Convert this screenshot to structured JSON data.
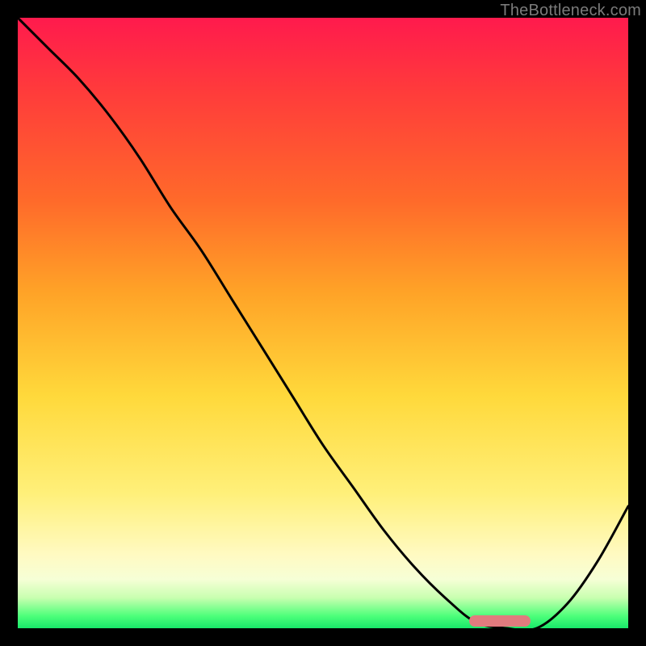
{
  "watermark": "TheBottleneck.com",
  "chart_data": {
    "type": "line",
    "title": "",
    "xlabel": "",
    "ylabel": "",
    "xlim": [
      0,
      100
    ],
    "ylim": [
      0,
      100
    ],
    "series": [
      {
        "name": "bottleneck-curve",
        "x": [
          0,
          5,
          10,
          15,
          20,
          25,
          30,
          35,
          40,
          45,
          50,
          55,
          60,
          65,
          70,
          75,
          80,
          85,
          90,
          95,
          100
        ],
        "y": [
          100,
          95,
          90,
          84,
          77,
          69,
          62,
          54,
          46,
          38,
          30,
          23,
          16,
          10,
          5,
          1,
          0,
          0,
          4,
          11,
          20
        ]
      }
    ],
    "optimal_range": {
      "start": 74,
      "end": 84,
      "y": 0
    },
    "gradient_stops": [
      {
        "pos": 0,
        "color": "#ff1a4d"
      },
      {
        "pos": 30,
        "color": "#ff6a2a"
      },
      {
        "pos": 62,
        "color": "#ffd93b"
      },
      {
        "pos": 92,
        "color": "#f6ffd6"
      },
      {
        "pos": 100,
        "color": "#18e86a"
      }
    ]
  }
}
